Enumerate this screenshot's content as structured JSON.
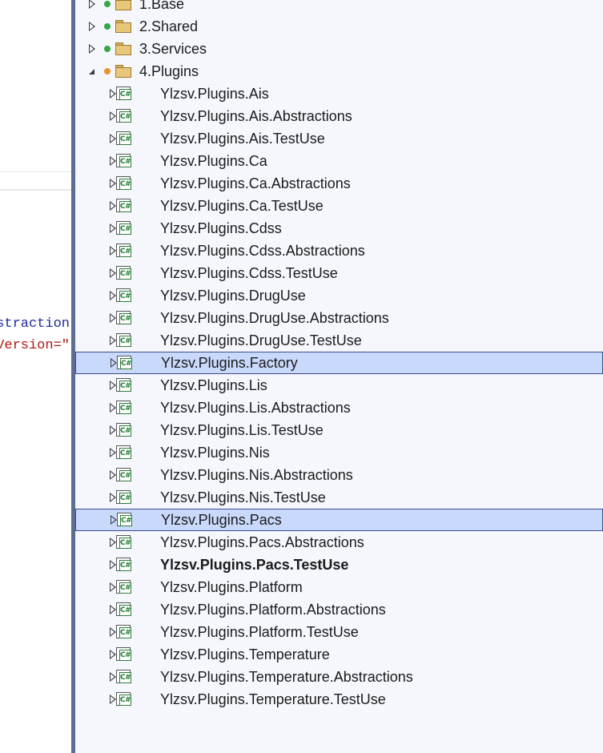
{
  "editor": {
    "code_lines": [
      "straction",
      "Version=\""
    ]
  },
  "colors": {
    "splitter": "#5f6d96",
    "tree_background": "#f5f7fd",
    "selection": "#c9d9fb",
    "status_ok": "#35a845",
    "status_modified": "#e7942a"
  },
  "tree": {
    "items": [
      {
        "label": "1.Base",
        "type": "folder",
        "level": 0,
        "expanded": false,
        "status": "green",
        "selected": false,
        "bold": false
      },
      {
        "label": "2.Shared",
        "type": "folder",
        "level": 0,
        "expanded": false,
        "status": "green",
        "selected": false,
        "bold": false
      },
      {
        "label": "3.Services",
        "type": "folder",
        "level": 0,
        "expanded": false,
        "status": "green",
        "selected": false,
        "bold": false
      },
      {
        "label": "4.Plugins",
        "type": "folder",
        "level": 0,
        "expanded": true,
        "status": "orange",
        "selected": false,
        "bold": false
      },
      {
        "label": "Ylzsv.Plugins.Ais",
        "type": "csproj",
        "level": 1,
        "expanded": false,
        "status": "green",
        "selected": false,
        "bold": false
      },
      {
        "label": "Ylzsv.Plugins.Ais.Abstractions",
        "type": "csproj",
        "level": 1,
        "expanded": false,
        "status": "green",
        "selected": false,
        "bold": false
      },
      {
        "label": "Ylzsv.Plugins.Ais.TestUse",
        "type": "csproj",
        "level": 1,
        "expanded": false,
        "status": "green",
        "selected": false,
        "bold": false
      },
      {
        "label": "Ylzsv.Plugins.Ca",
        "type": "csproj",
        "level": 1,
        "expanded": false,
        "status": "green",
        "selected": false,
        "bold": false
      },
      {
        "label": "Ylzsv.Plugins.Ca.Abstractions",
        "type": "csproj",
        "level": 1,
        "expanded": false,
        "status": "green",
        "selected": false,
        "bold": false
      },
      {
        "label": "Ylzsv.Plugins.Ca.TestUse",
        "type": "csproj",
        "level": 1,
        "expanded": false,
        "status": "green",
        "selected": false,
        "bold": false
      },
      {
        "label": "Ylzsv.Plugins.Cdss",
        "type": "csproj",
        "level": 1,
        "expanded": false,
        "status": "green",
        "selected": false,
        "bold": false
      },
      {
        "label": "Ylzsv.Plugins.Cdss.Abstractions",
        "type": "csproj",
        "level": 1,
        "expanded": false,
        "status": "green",
        "selected": false,
        "bold": false
      },
      {
        "label": "Ylzsv.Plugins.Cdss.TestUse",
        "type": "csproj",
        "level": 1,
        "expanded": false,
        "status": "green",
        "selected": false,
        "bold": false
      },
      {
        "label": "Ylzsv.Plugins.DrugUse",
        "type": "csproj",
        "level": 1,
        "expanded": false,
        "status": "green",
        "selected": false,
        "bold": false
      },
      {
        "label": "Ylzsv.Plugins.DrugUse.Abstractions",
        "type": "csproj",
        "level": 1,
        "expanded": false,
        "status": "green",
        "selected": false,
        "bold": false
      },
      {
        "label": "Ylzsv.Plugins.DrugUse.TestUse",
        "type": "csproj",
        "level": 1,
        "expanded": false,
        "status": "green",
        "selected": false,
        "bold": false
      },
      {
        "label": "Ylzsv.Plugins.Factory",
        "type": "csproj",
        "level": 1,
        "expanded": false,
        "status": "orange",
        "selected": true,
        "bold": false
      },
      {
        "label": "Ylzsv.Plugins.Lis",
        "type": "csproj",
        "level": 1,
        "expanded": false,
        "status": "green",
        "selected": false,
        "bold": false
      },
      {
        "label": "Ylzsv.Plugins.Lis.Abstractions",
        "type": "csproj",
        "level": 1,
        "expanded": false,
        "status": "green",
        "selected": false,
        "bold": false
      },
      {
        "label": "Ylzsv.Plugins.Lis.TestUse",
        "type": "csproj",
        "level": 1,
        "expanded": false,
        "status": "green",
        "selected": false,
        "bold": false
      },
      {
        "label": "Ylzsv.Plugins.Nis",
        "type": "csproj",
        "level": 1,
        "expanded": false,
        "status": "green",
        "selected": false,
        "bold": false
      },
      {
        "label": "Ylzsv.Plugins.Nis.Abstractions",
        "type": "csproj",
        "level": 1,
        "expanded": false,
        "status": "green",
        "selected": false,
        "bold": false
      },
      {
        "label": "Ylzsv.Plugins.Nis.TestUse",
        "type": "csproj",
        "level": 1,
        "expanded": false,
        "status": "green",
        "selected": false,
        "bold": false
      },
      {
        "label": "Ylzsv.Plugins.Pacs",
        "type": "csproj",
        "level": 1,
        "expanded": false,
        "status": "orange",
        "selected": true,
        "bold": false
      },
      {
        "label": "Ylzsv.Plugins.Pacs.Abstractions",
        "type": "csproj",
        "level": 1,
        "expanded": false,
        "status": "green",
        "selected": false,
        "bold": false
      },
      {
        "label": "Ylzsv.Plugins.Pacs.TestUse",
        "type": "csproj",
        "level": 1,
        "expanded": false,
        "status": "orange",
        "selected": false,
        "bold": true
      },
      {
        "label": "Ylzsv.Plugins.Platform",
        "type": "csproj",
        "level": 1,
        "expanded": false,
        "status": "green",
        "selected": false,
        "bold": false
      },
      {
        "label": "Ylzsv.Plugins.Platform.Abstractions",
        "type": "csproj",
        "level": 1,
        "expanded": false,
        "status": "green",
        "selected": false,
        "bold": false
      },
      {
        "label": "Ylzsv.Plugins.Platform.TestUse",
        "type": "csproj",
        "level": 1,
        "expanded": false,
        "status": "green",
        "selected": false,
        "bold": false
      },
      {
        "label": "Ylzsv.Plugins.Temperature",
        "type": "csproj",
        "level": 1,
        "expanded": false,
        "status": "green",
        "selected": false,
        "bold": false
      },
      {
        "label": "Ylzsv.Plugins.Temperature.Abstractions",
        "type": "csproj",
        "level": 1,
        "expanded": false,
        "status": "green",
        "selected": false,
        "bold": false
      },
      {
        "label": "Ylzsv.Plugins.Temperature.TestUse",
        "type": "csproj",
        "level": 1,
        "expanded": false,
        "status": "green",
        "selected": false,
        "bold": false
      }
    ]
  }
}
